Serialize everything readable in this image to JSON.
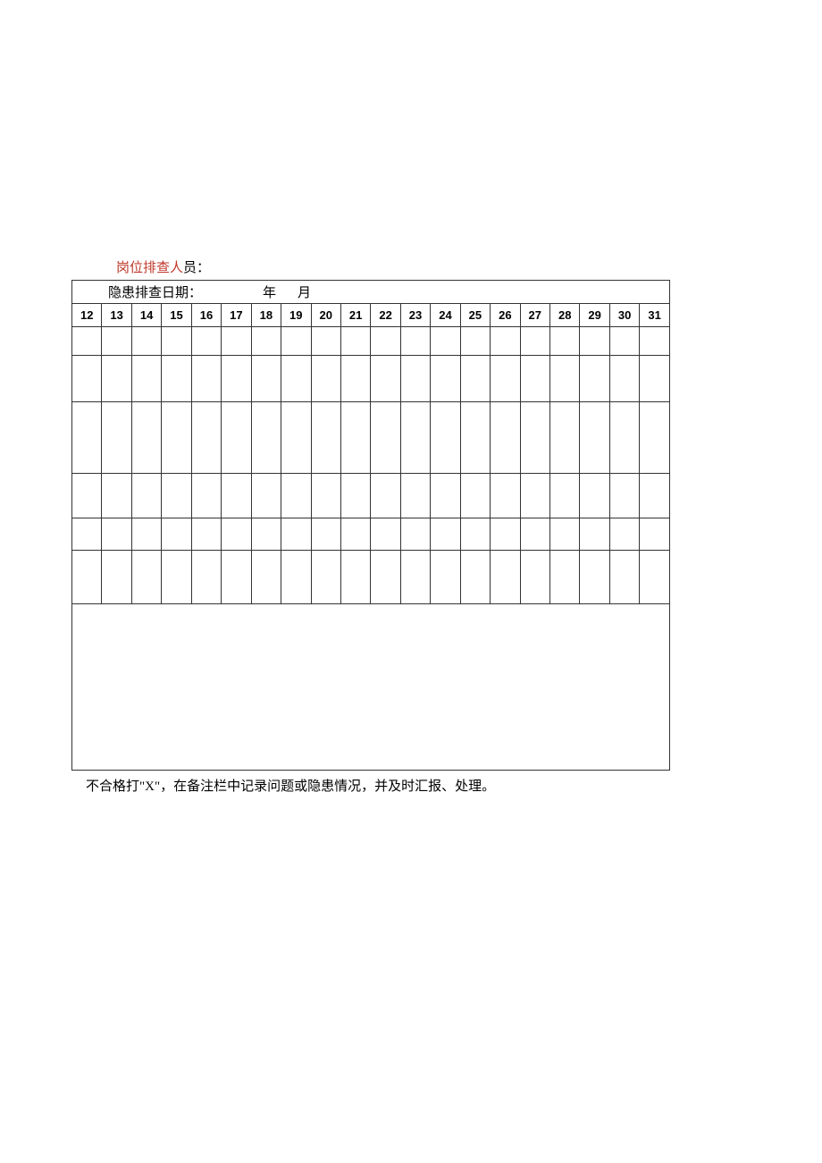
{
  "header": {
    "label_red": "岗位排查人",
    "label_black": "员："
  },
  "date_row": {
    "prefix": "隐患排查日期：",
    "year": "年",
    "month": "月"
  },
  "columns": [
    "12",
    "13",
    "14",
    "15",
    "16",
    "17",
    "18",
    "19",
    "20",
    "21",
    "22",
    "23",
    "24",
    "25",
    "26",
    "27",
    "28",
    "29",
    "30",
    "31"
  ],
  "footer_note": "不合格打\"X\"，在备注栏中记录问题或隐患情况，并及时汇报、处理。"
}
